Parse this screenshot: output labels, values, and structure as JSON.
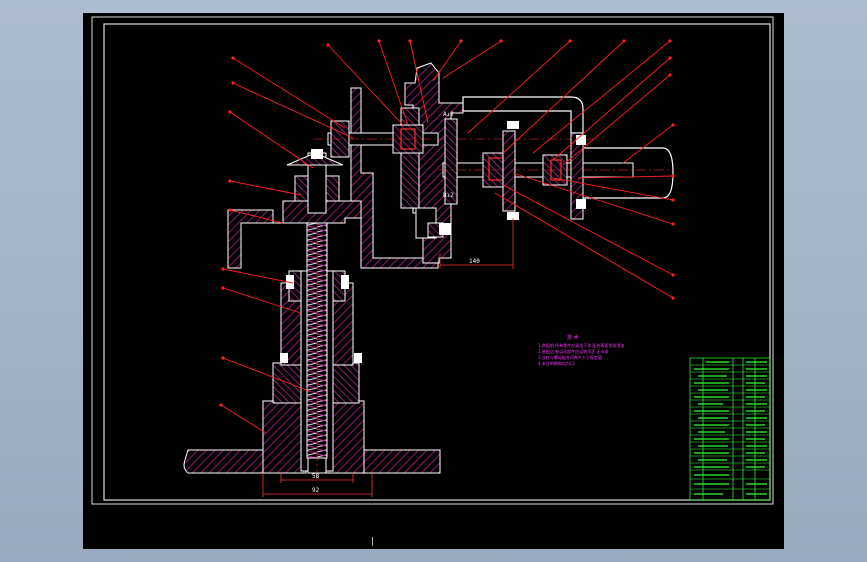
{
  "colors": {
    "background": "#000000",
    "outline": "#ffffff",
    "hatch": "#b0208f",
    "dimension": "#ff2020",
    "notes": "#ff33ff",
    "title_block": "#33ff33"
  },
  "drawing": {
    "dimensions": {
      "d_140": "140",
      "d_bottom_inner": "58",
      "d_bottom_outer": "92"
    },
    "view_annotations": {
      "label_a": "A↓2",
      "label_b": "B↓2"
    },
    "notes_heading": "技 术",
    "notes_lines": [
      "1.装配前 所有零件应清洗干净 配合表面涂润滑油",
      "2.装配后 各运动部件应运转灵活 无卡滞",
      "3.丝杠与螺母配合间隙不大于规定值",
      "4.未注明倒角均为C1"
    ],
    "page_marker": "|"
  }
}
